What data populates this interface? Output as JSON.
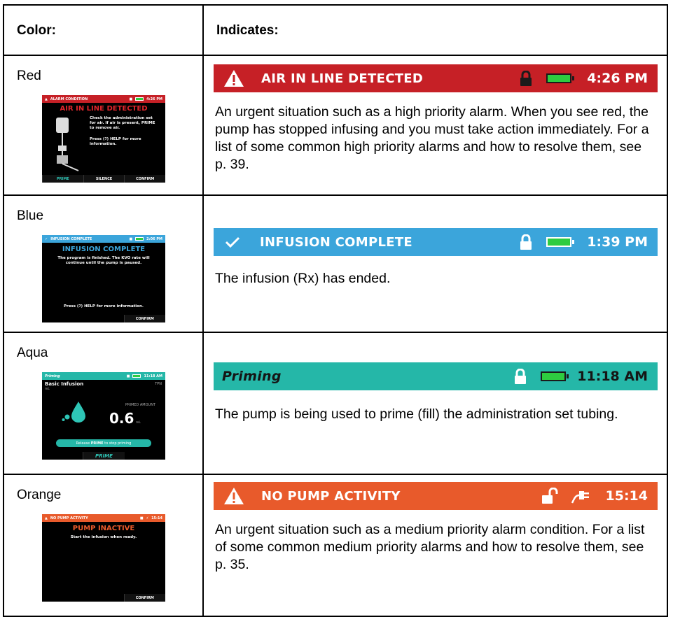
{
  "header": {
    "col1": "Color:",
    "col2": "Indicates:"
  },
  "rows": [
    {
      "color_name": "Red",
      "banner": {
        "text": "AIR IN LINE DETECTED",
        "time": "4:26 PM",
        "bg": "#c62026"
      },
      "description": "An urgent situation such as a high priority alarm. When you see red, the pump has stopped infusing and you must take action immediately. For a list of some common high priority alarms and how to resolve them, see p. 39.",
      "thumb": {
        "bar_label": "ALARM CONDITION",
        "bar_time": "4:26 PM",
        "title": "AIR IN LINE DETECTED",
        "body1": "Check the administration set for air. If air is present, PRIME to remove air.",
        "body2": "Press (?) HELP for more information.",
        "buttons": [
          "PRIME",
          "SILENCE",
          "CONFIRM"
        ]
      }
    },
    {
      "color_name": "Blue",
      "banner": {
        "text": "INFUSION COMPLETE",
        "time": "1:39 PM",
        "bg": "#3ba5db"
      },
      "description": "The infusion (Rx) has ended.",
      "thumb": {
        "bar_label": "INFUSION COMPLETE",
        "bar_time": "2:06 PM",
        "title": "INFUSION COMPLETE",
        "body1": "The program is finished. The KVO rate will continue until the pump is paused.",
        "body2": "Press (?) HELP for more information.",
        "buttons": [
          "CONFIRM"
        ]
      }
    },
    {
      "color_name": "Aqua",
      "banner": {
        "text": "Priming",
        "time": "11:18 AM",
        "bg": "#25b7a8"
      },
      "description": "The pump is being used to prime (fill) the administration set tubing.",
      "thumb": {
        "bar_label": "Priming",
        "bar_time": "11:18 AM",
        "title": "Basic Infusion",
        "tag": "TPN",
        "unit_small": "mL",
        "primed_label": "PRIMED AMOUNT",
        "primed_value": "0.6",
        "primed_unit": "mL",
        "release_prefix": "Release ",
        "release_bold": "PRIME",
        "release_suffix": " to stop priming",
        "buttons": [
          "PRIME"
        ]
      }
    },
    {
      "color_name": "Orange",
      "banner": {
        "text": "NO PUMP ACTIVITY",
        "time": "15:14",
        "bg": "#e85a2b"
      },
      "description": "An urgent situation such as a medium priority alarm condition. For a list of some common medium priority alarms and how to resolve them, see p. 35.",
      "thumb": {
        "bar_label": "NO PUMP ACTIVITY",
        "bar_time": "15:14",
        "title": "PUMP INACTIVE",
        "body1": "Start the infusion when ready.",
        "buttons": [
          "CONFIRM"
        ]
      }
    }
  ]
}
